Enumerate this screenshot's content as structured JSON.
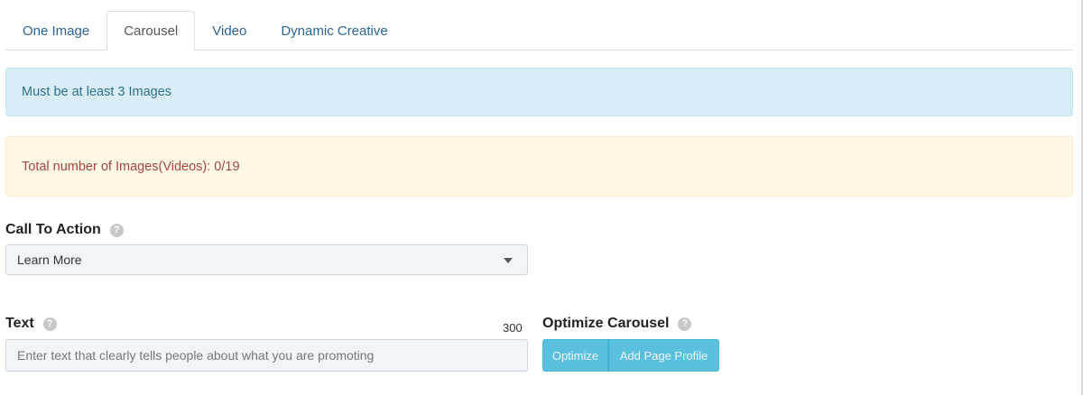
{
  "tabs": [
    {
      "label": "One Image",
      "active": false
    },
    {
      "label": "Carousel",
      "active": true
    },
    {
      "label": "Video",
      "active": false
    },
    {
      "label": "Dynamic Creative",
      "active": false
    }
  ],
  "alerts": {
    "info": "Must be at least 3 Images",
    "warning": "Total number of Images(Videos): 0/19"
  },
  "call_to_action": {
    "label": "Call To Action",
    "help_icon": "question-circle-icon",
    "selected": "Learn More"
  },
  "text_field": {
    "label": "Text",
    "help_icon": "question-circle-icon",
    "counter": "300",
    "placeholder": "Enter text that clearly tells people about what you are promoting",
    "value": ""
  },
  "optimize_carousel": {
    "label": "Optimize Carousel",
    "help_icon": "question-circle-icon",
    "optimize_label": "Optimize",
    "add_profile_label": "Add Page Profile"
  },
  "colors": {
    "link": "#2a6496",
    "info_bg": "#d9edf7",
    "info_text": "#31708f",
    "warning_bg": "#fcf8e3",
    "warning_text": "#a94442",
    "button_bg": "#5bc0de"
  }
}
